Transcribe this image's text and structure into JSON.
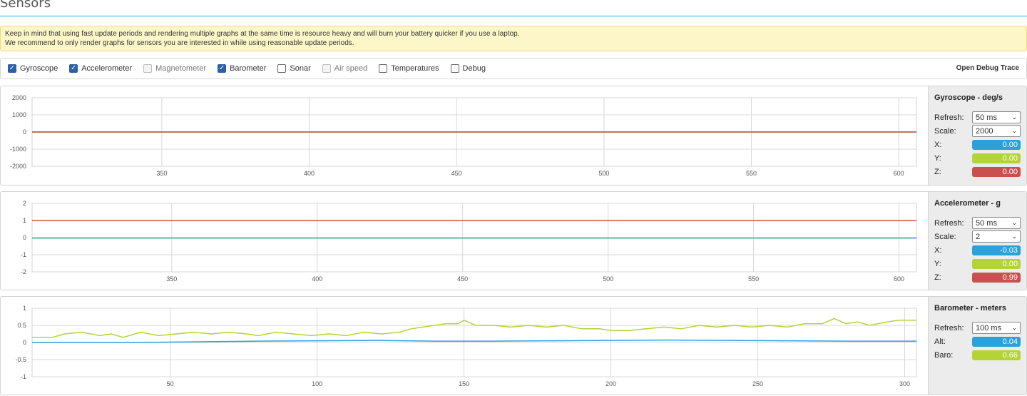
{
  "page": {
    "title": "Sensors"
  },
  "notice": {
    "line1": "Keep in mind that using fast update periods and rendering multiple graphs at the same time is resource heavy and will burn your battery quicker if you use a laptop.",
    "line2": "We recommend to only render graphs for sensors you are interested in while using reasonable update periods."
  },
  "toolbar": {
    "checkboxes": [
      {
        "label": "Gyroscope",
        "checked": true,
        "disabled": false
      },
      {
        "label": "Accelerometer",
        "checked": true,
        "disabled": false
      },
      {
        "label": "Magnetometer",
        "checked": false,
        "disabled": true
      },
      {
        "label": "Barometer",
        "checked": true,
        "disabled": false
      },
      {
        "label": "Sonar",
        "checked": false,
        "disabled": false
      },
      {
        "label": "Air speed",
        "checked": false,
        "disabled": true
      },
      {
        "label": "Temperatures",
        "checked": false,
        "disabled": false
      },
      {
        "label": "Debug",
        "checked": false,
        "disabled": false
      }
    ],
    "debug_trace": "Open Debug Trace"
  },
  "colors": {
    "x": "#2aa1d8",
    "y": "#b3d337",
    "z": "#c9504f",
    "title_rule": "#37a8db"
  },
  "gyro": {
    "title": "Gyroscope - deg/s",
    "refresh_label": "Refresh:",
    "refresh": "50 ms",
    "scale_label": "Scale:",
    "scale": "2000",
    "x_label": "X:",
    "x": "0.00",
    "y_label": "Y:",
    "y": "0.00",
    "z_label": "Z:",
    "z": "0.00"
  },
  "accel": {
    "title": "Accelerometer - g",
    "refresh_label": "Refresh:",
    "refresh": "50 ms",
    "scale_label": "Scale:",
    "scale": "2",
    "x_label": "X:",
    "x": "-0.03",
    "y_label": "Y:",
    "y": "0.00",
    "z_label": "Z:",
    "z": "0.99"
  },
  "baro": {
    "title": "Barometer - meters",
    "refresh_label": "Refresh:",
    "refresh": "100 ms",
    "alt_label": "Alt:",
    "alt": "0.04",
    "baro_label": "Baro:",
    "baro": "0.66"
  },
  "chart_data": [
    {
      "type": "line",
      "title": "",
      "x_range": [
        306,
        606
      ],
      "ylim": [
        -2000,
        2000
      ],
      "y_ticks": [
        2000,
        1000,
        0,
        -1000,
        -2000
      ],
      "x_ticks": [
        350,
        400,
        450,
        500,
        550,
        600
      ],
      "series": [
        {
          "color": "#2aa1d8",
          "const": 0
        },
        {
          "color": "#b3d337",
          "const": 0
        },
        {
          "color": "#c9504f",
          "const": 0
        }
      ]
    },
    {
      "type": "line",
      "title": "",
      "x_range": [
        302,
        606
      ],
      "ylim": [
        -2,
        2
      ],
      "y_ticks": [
        2,
        1,
        0,
        -1,
        -2
      ],
      "x_ticks": [
        350,
        400,
        450,
        500,
        550,
        600
      ],
      "series": [
        {
          "color": "#2aa1d8",
          "const": -0.03
        },
        {
          "color": "#b3d337",
          "const": 0.0
        },
        {
          "color": "#c9504f",
          "const": 0.99
        }
      ]
    },
    {
      "type": "line",
      "title": "",
      "x_range": [
        3,
        304
      ],
      "ylim": [
        -1,
        1
      ],
      "y_ticks": [
        1,
        0.5,
        0,
        -0.5,
        -1
      ],
      "x_ticks": [
        50,
        100,
        150,
        200,
        250,
        300
      ],
      "series": [
        {
          "color": "#b3d337",
          "points": [
            [
              3,
              0.15
            ],
            [
              10,
              0.15
            ],
            [
              14,
              0.25
            ],
            [
              20,
              0.3
            ],
            [
              26,
              0.2
            ],
            [
              30,
              0.25
            ],
            [
              34,
              0.15
            ],
            [
              40,
              0.3
            ],
            [
              46,
              0.2
            ],
            [
              52,
              0.25
            ],
            [
              58,
              0.3
            ],
            [
              64,
              0.25
            ],
            [
              70,
              0.3
            ],
            [
              76,
              0.25
            ],
            [
              80,
              0.2
            ],
            [
              86,
              0.3
            ],
            [
              92,
              0.25
            ],
            [
              98,
              0.2
            ],
            [
              104,
              0.25
            ],
            [
              110,
              0.2
            ],
            [
              116,
              0.3
            ],
            [
              122,
              0.25
            ],
            [
              128,
              0.3
            ],
            [
              132,
              0.4
            ],
            [
              136,
              0.45
            ],
            [
              140,
              0.5
            ],
            [
              144,
              0.55
            ],
            [
              148,
              0.55
            ],
            [
              150,
              0.65
            ],
            [
              154,
              0.5
            ],
            [
              160,
              0.5
            ],
            [
              166,
              0.45
            ],
            [
              172,
              0.5
            ],
            [
              178,
              0.45
            ],
            [
              184,
              0.5
            ],
            [
              190,
              0.4
            ],
            [
              196,
              0.4
            ],
            [
              200,
              0.35
            ],
            [
              206,
              0.35
            ],
            [
              212,
              0.4
            ],
            [
              218,
              0.45
            ],
            [
              224,
              0.4
            ],
            [
              230,
              0.5
            ],
            [
              236,
              0.45
            ],
            [
              242,
              0.5
            ],
            [
              248,
              0.45
            ],
            [
              254,
              0.5
            ],
            [
              260,
              0.45
            ],
            [
              266,
              0.55
            ],
            [
              272,
              0.55
            ],
            [
              276,
              0.7
            ],
            [
              280,
              0.55
            ],
            [
              284,
              0.6
            ],
            [
              288,
              0.5
            ],
            [
              294,
              0.6
            ],
            [
              298,
              0.65
            ],
            [
              304,
              0.65
            ]
          ]
        },
        {
          "color": "#2aa1d8",
          "points": [
            [
              3,
              0.0
            ],
            [
              40,
              0.0
            ],
            [
              60,
              0.02
            ],
            [
              80,
              0.04
            ],
            [
              100,
              0.05
            ],
            [
              120,
              0.06
            ],
            [
              140,
              0.04
            ],
            [
              160,
              0.04
            ],
            [
              180,
              0.05
            ],
            [
              200,
              0.06
            ],
            [
              220,
              0.07
            ],
            [
              240,
              0.06
            ],
            [
              260,
              0.05
            ],
            [
              280,
              0.04
            ],
            [
              304,
              0.04
            ]
          ]
        }
      ]
    }
  ]
}
